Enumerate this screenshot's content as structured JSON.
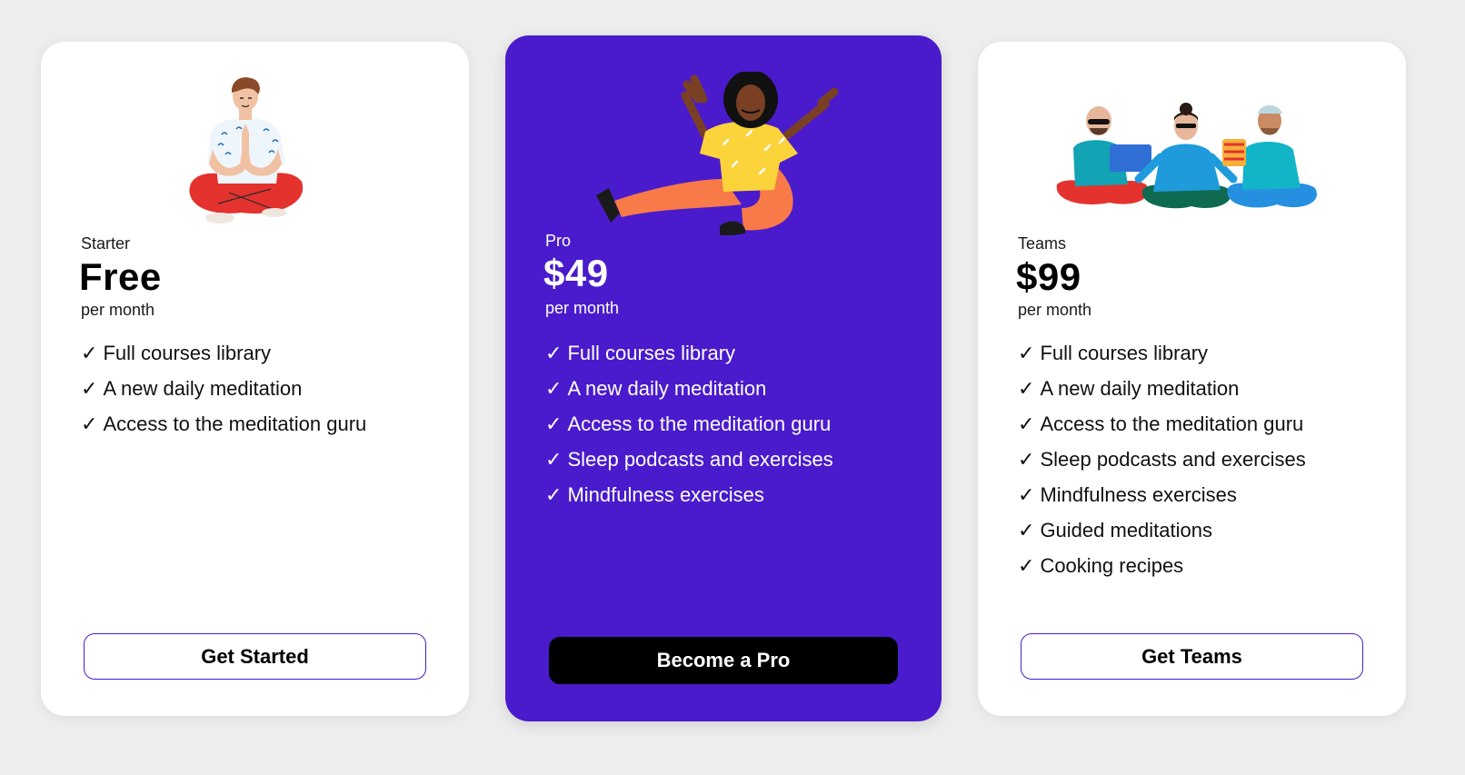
{
  "plans": [
    {
      "name": "Starter",
      "price": "Free",
      "period": "per month",
      "illustration": "meditating-man-icon",
      "features": [
        "Full courses library",
        "A new daily meditation",
        "Access to the meditation guru"
      ],
      "button_label": "Get Started"
    },
    {
      "name": "Pro",
      "price": "$49",
      "period": "per month",
      "illustration": "floating-woman-icon",
      "features": [
        "Full courses library",
        "A new daily meditation",
        "Access to the meditation guru",
        "Sleep podcasts and exercises",
        "Mindfulness exercises"
      ],
      "button_label": "Become a Pro"
    },
    {
      "name": "Teams",
      "price": "$99",
      "period": "per month",
      "illustration": "meditating-team-icon",
      "features": [
        "Full courses library",
        "A new daily meditation",
        "Access to the meditation guru",
        "Sleep podcasts and exercises",
        "Mindfulness exercises",
        "Guided meditations",
        "Cooking recipes"
      ],
      "button_label": "Get Teams"
    }
  ],
  "check_glyph": "✓",
  "colors": {
    "background": "#ededed",
    "accent": "#4a1bcc",
    "card": "#ffffff",
    "button_dark": "#000000"
  }
}
